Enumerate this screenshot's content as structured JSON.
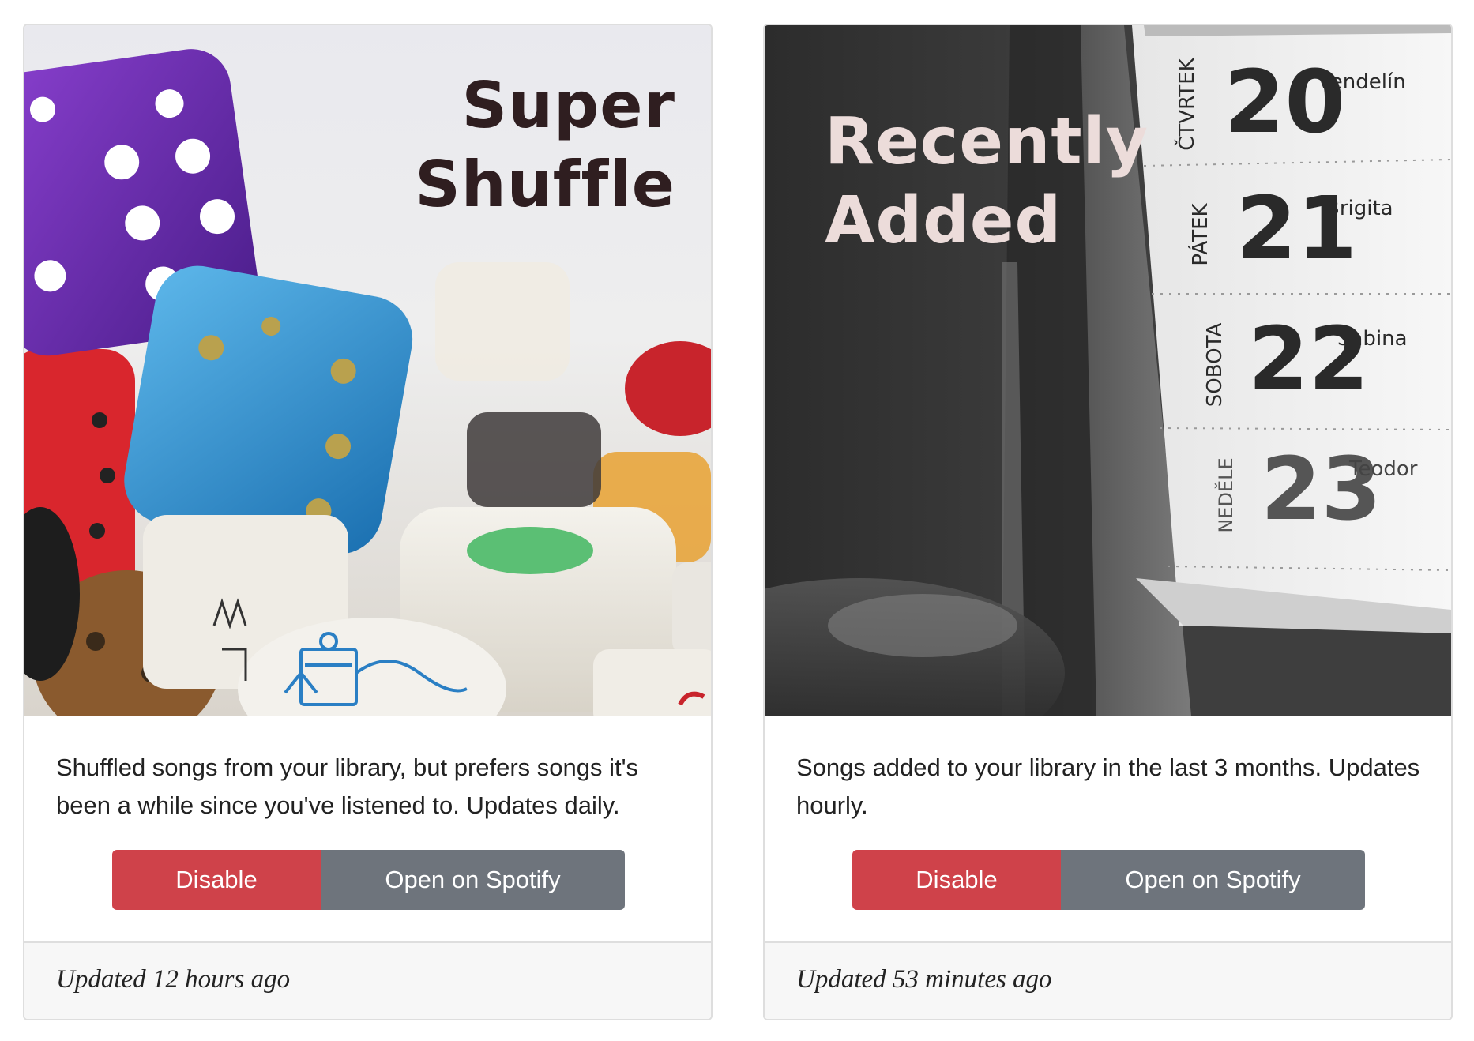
{
  "cards": [
    {
      "title_line1": "Super",
      "title_line2": "Shuffle",
      "image_alt": "dice",
      "description": "Shuffled songs from your library, but prefers songs it's been a while since you've listened to. Updates daily.",
      "disable_label": "Disable",
      "open_label": "Open on Spotify",
      "updated": "Updated 12 hours ago"
    },
    {
      "title_line1": "Recently",
      "title_line2": "Added",
      "image_alt": "calendar",
      "description": "Songs added to your library in the last 3 months. Updates hourly.",
      "disable_label": "Disable",
      "open_label": "Open on Spotify",
      "updated": "Updated 53 minutes ago",
      "calendar": [
        {
          "day": "ČTVRTEK",
          "num": "20",
          "name": "Vendelín"
        },
        {
          "day": "PÁTEK",
          "num": "21",
          "name": "Brigita"
        },
        {
          "day": "SOBOTA",
          "num": "22",
          "name": "Sabina"
        },
        {
          "day": "NEDĚLE",
          "num": "23",
          "name": "Teodor"
        }
      ]
    }
  ],
  "colors": {
    "disable": "#cf424a",
    "open": "#6e747c",
    "title_dark": "#2f1e20",
    "title_light": "#ecdcda"
  }
}
